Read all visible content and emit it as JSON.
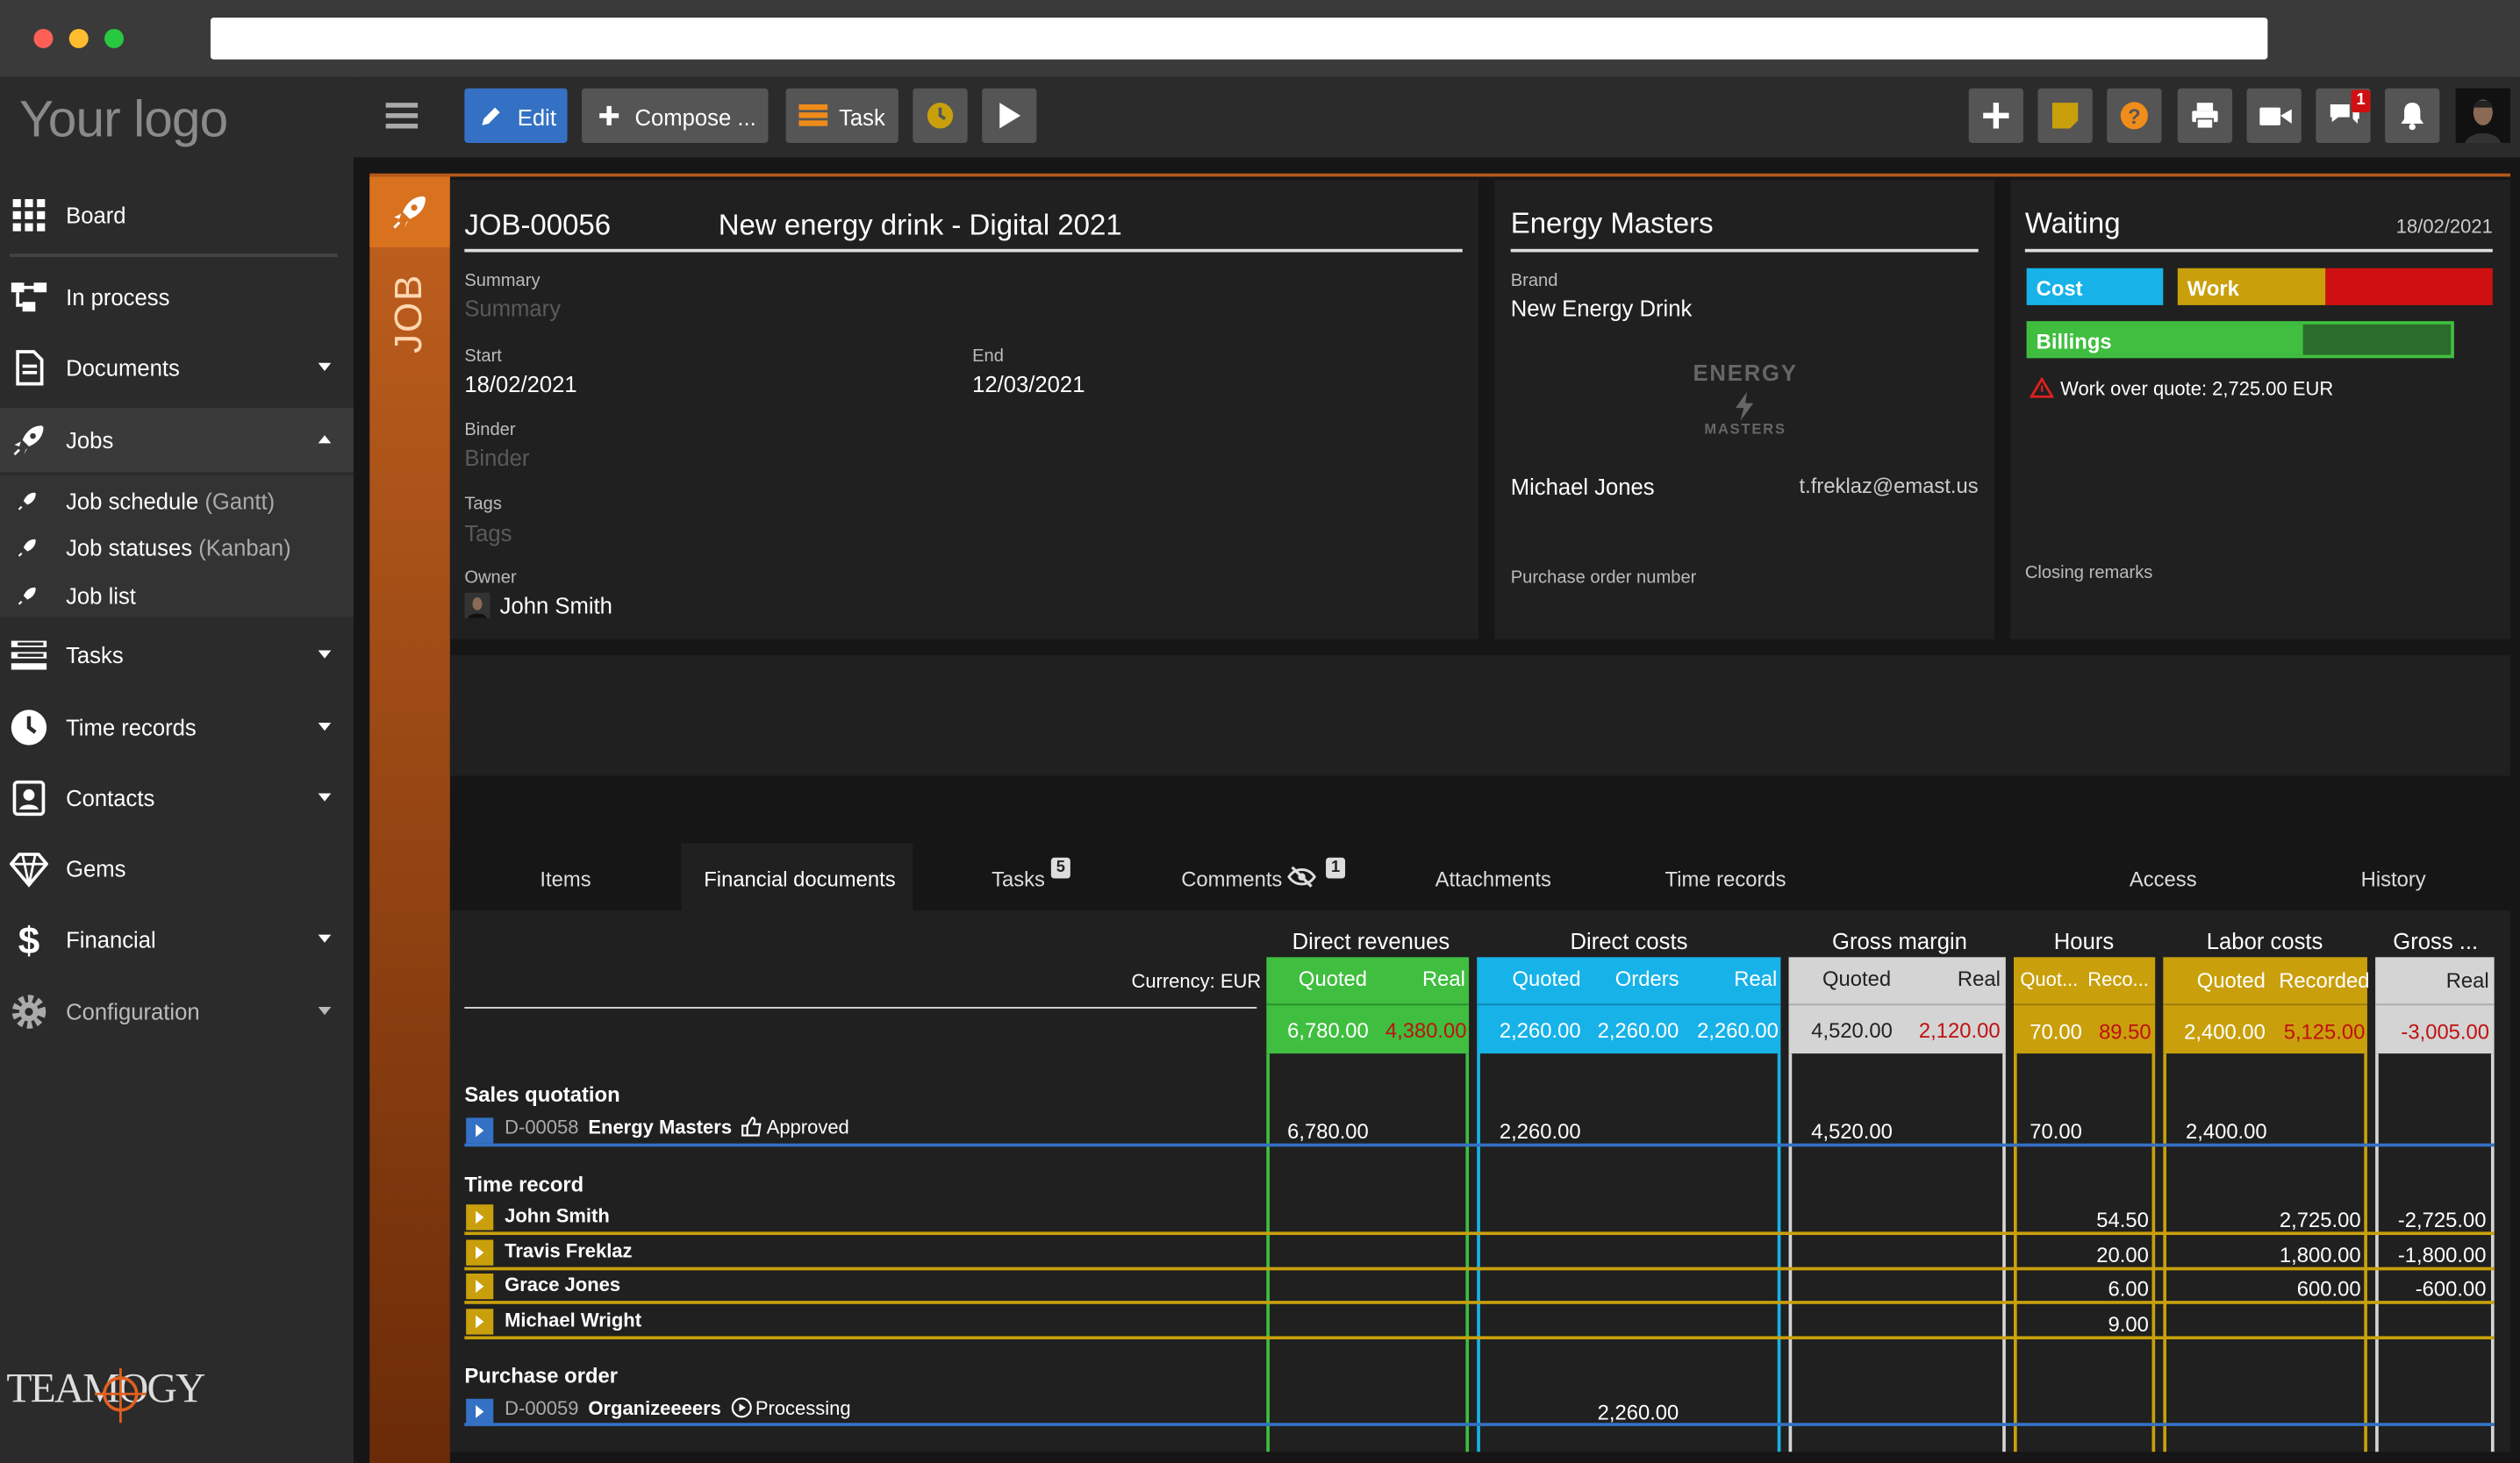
{
  "app": {
    "logo_text": "Your logo",
    "brand": "TEAMOGY"
  },
  "sidebar": {
    "items": [
      {
        "label": "Board",
        "icon": "grid-icon"
      },
      {
        "label": "In process",
        "icon": "workflow-icon"
      },
      {
        "label": "Documents",
        "icon": "document-icon"
      },
      {
        "label": "Jobs",
        "icon": "rocket-icon"
      },
      {
        "label": "Tasks",
        "icon": "tasks-icon"
      },
      {
        "label": "Time records",
        "icon": "clock-icon"
      },
      {
        "label": "Contacts",
        "icon": "contact-icon"
      },
      {
        "label": "Gems",
        "icon": "gem-icon"
      },
      {
        "label": "Financial",
        "icon": "dollar-icon"
      },
      {
        "label": "Configuration",
        "icon": "gear-icon"
      }
    ],
    "jobs_sub": [
      {
        "label": "Job schedule",
        "suffix": "(Gantt)"
      },
      {
        "label": "Job statuses",
        "suffix": "(Kanban)"
      },
      {
        "label": "Job list",
        "suffix": ""
      }
    ]
  },
  "toolbar": {
    "edit": "Edit",
    "compose": "Compose ...",
    "task": "Task",
    "chat_badge": "1"
  },
  "job": {
    "vertical_label": "JOB",
    "number": "JOB-00056",
    "title": "New energy drink - Digital 2021",
    "summary_label": "Summary",
    "summary_placeholder": "Summary",
    "start_label": "Start",
    "start": "18/02/2021",
    "end_label": "End",
    "end": "12/03/2021",
    "binder_label": "Binder",
    "binder_placeholder": "Binder",
    "tags_label": "Tags",
    "tags_placeholder": "Tags",
    "owner_label": "Owner",
    "owner": "John Smith"
  },
  "client": {
    "name": "Energy Masters",
    "brand_label": "Brand",
    "brand": "New Energy Drink",
    "logo_line1": "ENERGY",
    "logo_line2": "MASTERS",
    "contact": "Michael Jones",
    "email": "t.freklaz@emast.us",
    "po_label": "Purchase order number"
  },
  "status": {
    "label": "Waiting",
    "date": "18/02/2021",
    "cost": "Cost",
    "work": "Work",
    "billings": "Billings",
    "billings_fraction": 0.65,
    "warning": "Work over quote: 2,725.00 EUR",
    "closing": "Closing remarks"
  },
  "tabs": [
    "Items",
    "Financial documents",
    "Tasks",
    "Comments",
    "Attachments",
    "Time records",
    "Access",
    "History"
  ],
  "tab_badges": {
    "tasks": "5",
    "comments": "1"
  },
  "active_tab": "Financial documents",
  "colors": {
    "green": "#3fbe3f",
    "blue": "#17b2e8",
    "gold": "#c9a00c",
    "gray": "#d4d4d4",
    "red": "#d01010",
    "accent": "#b55a1c"
  },
  "fin": {
    "currency": "Currency: EUR",
    "groups": {
      "dr": "Direct revenues",
      "dc": "Direct costs",
      "gm": "Gross margin",
      "hr": "Hours",
      "lc": "Labor costs",
      "gp": "Gross ..."
    },
    "heads": {
      "dr_q": "Quoted",
      "dr_r": "Real",
      "dc_q": "Quoted",
      "dc_o": "Orders",
      "dc_r": "Real",
      "gm_q": "Quoted",
      "gm_r": "Real",
      "hr_q": "Quot...",
      "hr_r": "Reco...",
      "lc_q": "Quoted",
      "lc_r": "Recorded",
      "gp_r": "Real"
    },
    "totals": {
      "dr_q": "6,780.00",
      "dr_r": "4,380.00",
      "dc_q": "2,260.00",
      "dc_o": "2,260.00",
      "dc_r": "2,260.00",
      "gm_q": "4,520.00",
      "gm_r": "2,120.00",
      "hr_q": "70.00",
      "hr_r": "89.50",
      "lc_q": "2,400.00",
      "lc_r": "5,125.00",
      "gp_r": "-3,005.00"
    },
    "sales": {
      "section": "Sales quotation",
      "doc": "D-00058",
      "party": "Energy Masters",
      "state": "Approved",
      "dr": "6,780.00",
      "dc": "2,260.00",
      "gm": "4,520.00",
      "hr": "70.00",
      "lc": "2,400.00"
    },
    "time": {
      "section": "Time record",
      "rows": [
        {
          "name": "John Smith",
          "hours": "54.50",
          "labor": "2,725.00",
          "gross": "-2,725.00"
        },
        {
          "name": "Travis Freklaz",
          "hours": "20.00",
          "labor": "1,800.00",
          "gross": "-1,800.00"
        },
        {
          "name": "Grace Jones",
          "hours": "6.00",
          "labor": "600.00",
          "gross": "-600.00"
        },
        {
          "name": "Michael Wright",
          "hours": "9.00",
          "labor": "",
          "gross": ""
        }
      ]
    },
    "po": {
      "section": "Purchase order",
      "doc": "D-00059",
      "party": "Organizeeeers",
      "state": "Processing",
      "dc": "2,260.00"
    }
  }
}
